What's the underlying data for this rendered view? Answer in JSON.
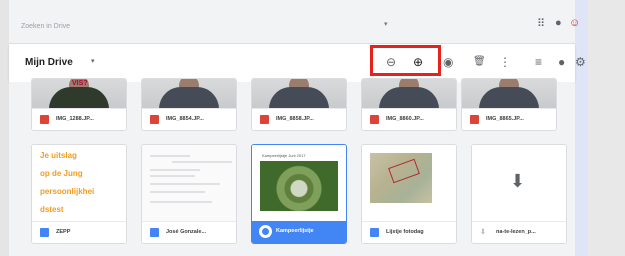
{
  "search": {
    "placeholder": "Zoeken in Drive",
    "caret": "▾"
  },
  "top_icons": {
    "apps": "⠿",
    "account": "●",
    "avatar": "☺"
  },
  "toolbar": {
    "title": "Mijn Drive",
    "caret": "▾",
    "link_icon": "⊖",
    "share_icon": "⊕",
    "preview_icon": "◉",
    "delete_icon": "🗑",
    "more_icon": "⋮",
    "list_view_icon": "≡",
    "info_icon": "●",
    "settings_icon": "⚙"
  },
  "partial_photo_label": "VIS?",
  "photos": [
    {
      "name": "IMG_1288.JP..."
    },
    {
      "name": "IMG_8854.JP..."
    },
    {
      "name": "IMG_8858.JP..."
    },
    {
      "name": "IMG_8860.JP..."
    },
    {
      "name": "IMG_8865.JP..."
    }
  ],
  "docs": [
    {
      "name": "ZEPP",
      "lines": [
        "Je uitslag",
        "op de Jung",
        "persoonlijkhei",
        "dstest"
      ]
    },
    {
      "name": "José Gonzale..."
    },
    {
      "name": "Kampeerlijstje",
      "caption": "Kampeerlijstje Juni 2017"
    },
    {
      "name": "Lijstje fotodag"
    },
    {
      "name": "na-te-lezen_p...",
      "prefix": "⇩"
    }
  ],
  "accent_colors": {
    "highlight": "#e5231c",
    "selected": "#4285f4",
    "image_icon": "#db4437",
    "doc_icon": "#4285f4",
    "orange_text": "#f29c1f"
  }
}
